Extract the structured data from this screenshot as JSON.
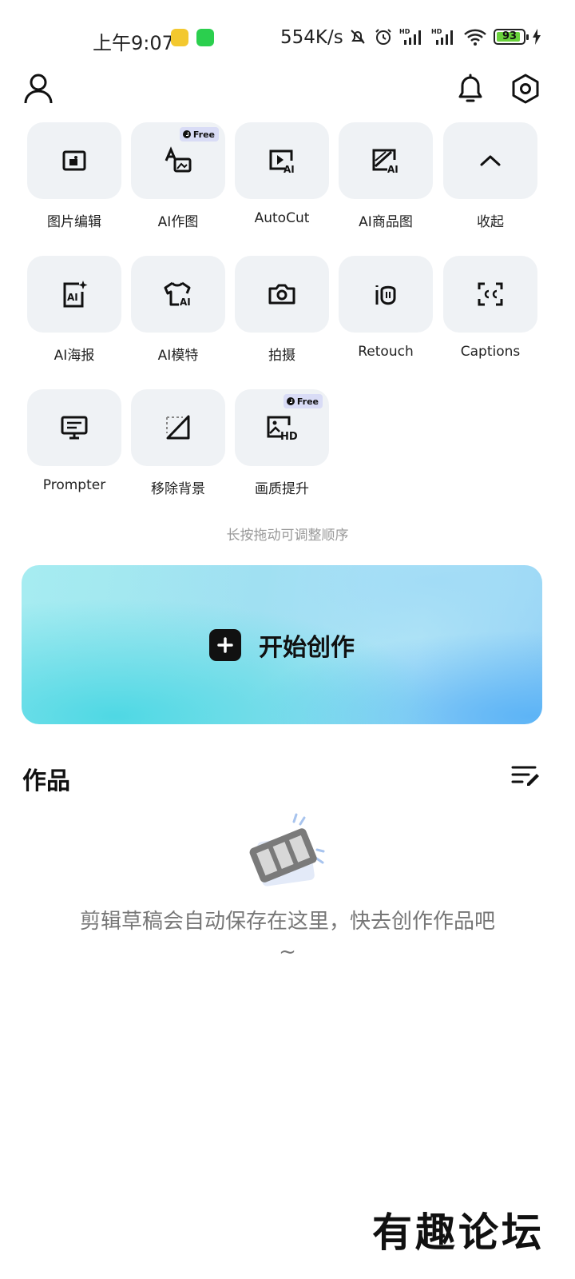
{
  "status_bar": {
    "time": "上午9:07",
    "net_speed": "554K/s",
    "battery": "93",
    "battery_level": 0.93,
    "icons": [
      "weibo-icon",
      "wechat-icon",
      "mute-bell-icon",
      "alarm-icon",
      "hd-signal-icon",
      "hd-signal-icon",
      "wifi-icon",
      "battery-icon",
      "charging-icon"
    ]
  },
  "header": {
    "icons": [
      "profile-icon",
      "notification-bell-icon",
      "settings-icon"
    ]
  },
  "tools": [
    {
      "label": "图片编辑",
      "icon": "image-edit-icon"
    },
    {
      "label": "AI作图",
      "icon": "ai-image-icon",
      "badge": "Free"
    },
    {
      "label": "AutoCut",
      "icon": "autocut-icon"
    },
    {
      "label": "AI商品图",
      "icon": "ai-product-icon"
    },
    {
      "label": "收起",
      "icon": "chevron-up-icon"
    },
    {
      "label": "AI海报",
      "icon": "ai-poster-icon"
    },
    {
      "label": "AI模特",
      "icon": "ai-model-icon"
    },
    {
      "label": "拍摄",
      "icon": "camera-icon"
    },
    {
      "label": "Retouch",
      "icon": "retouch-icon"
    },
    {
      "label": "Captions",
      "icon": "captions-icon"
    },
    {
      "label": "Prompter",
      "icon": "prompter-icon"
    },
    {
      "label": "移除背景",
      "icon": "remove-bg-icon"
    },
    {
      "label": "画质提升",
      "icon": "hd-enhance-icon",
      "badge": "Free"
    }
  ],
  "hint": "长按拖动可调整顺序",
  "create_button": {
    "label": "开始创作",
    "icon": "plus-icon"
  },
  "works": {
    "title": "作品",
    "edit_icon": "list-edit-icon",
    "empty_text": "剪辑草稿会自动保存在这里，快去创作作品吧~",
    "empty_icon": "film-strip-icon"
  },
  "watermark": "有趣论坛",
  "colors": {
    "tile_bg": "#eff2f5",
    "free_badge_bg": "#d9dcf6",
    "battery_green": "#6ad23c",
    "banner_cyan": "#4fd8e4",
    "banner_blue": "#5db4f6"
  }
}
